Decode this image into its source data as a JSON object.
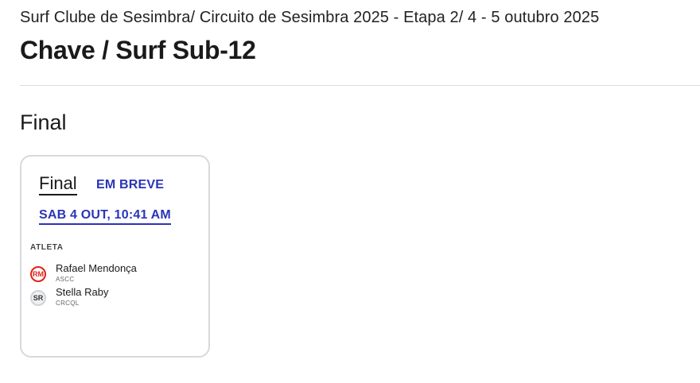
{
  "header": {
    "event_title": "Surf Clube de Sesimbra/ Circuito de Sesimbra 2025 - Etapa 2/ 4 - 5 outubro 2025",
    "page_title": "Chave / Surf Sub-12"
  },
  "round": {
    "title": "Final"
  },
  "heat": {
    "name": "Final",
    "status": "EM BREVE",
    "time": "SAB 4 OUT, 10:41 AM",
    "athletes_header": "ATLETA",
    "athletes": [
      {
        "initials": "RM",
        "name": "Rafael Mendonça",
        "club": "ASCC",
        "badge_color": "#e1231a"
      },
      {
        "initials": "SR",
        "name": "Stella Raby",
        "club": "CRCQL",
        "badge_color": "#cfd2d6"
      }
    ]
  },
  "colors": {
    "accent": "#2a35b8",
    "divider": "#dcdcdc",
    "card_border": "#d7d9de"
  }
}
